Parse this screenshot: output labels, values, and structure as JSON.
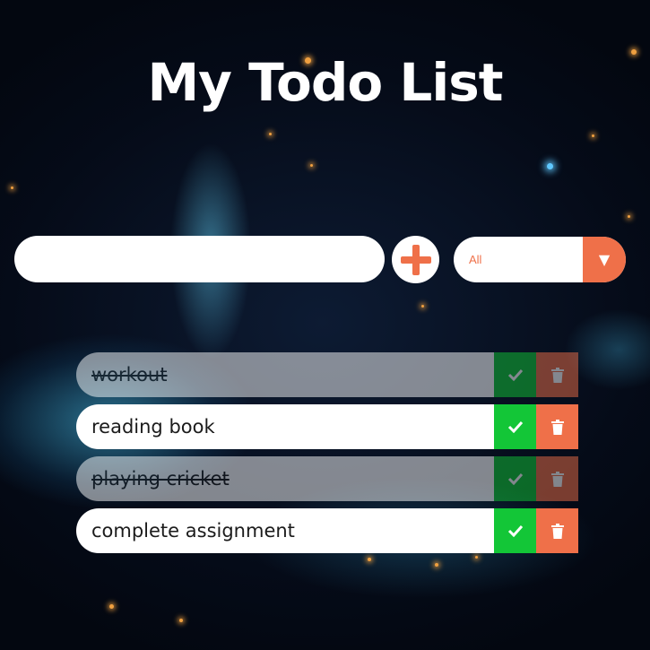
{
  "app": {
    "title": "My Todo List"
  },
  "form": {
    "input_value": "",
    "input_placeholder": "",
    "add_icon": "plus-icon",
    "filter": {
      "selected": "All",
      "arrow": "▼"
    }
  },
  "todos": [
    {
      "text": "workout",
      "completed": true
    },
    {
      "text": "reading book",
      "completed": false
    },
    {
      "text": "playing cricket",
      "completed": true
    },
    {
      "text": "complete assignment",
      "completed": false
    }
  ],
  "icons": {
    "check": "check-icon",
    "trash": "trash-icon"
  },
  "colors": {
    "accent": "#ef7049",
    "complete": "#13c637",
    "background": "#050b18"
  }
}
